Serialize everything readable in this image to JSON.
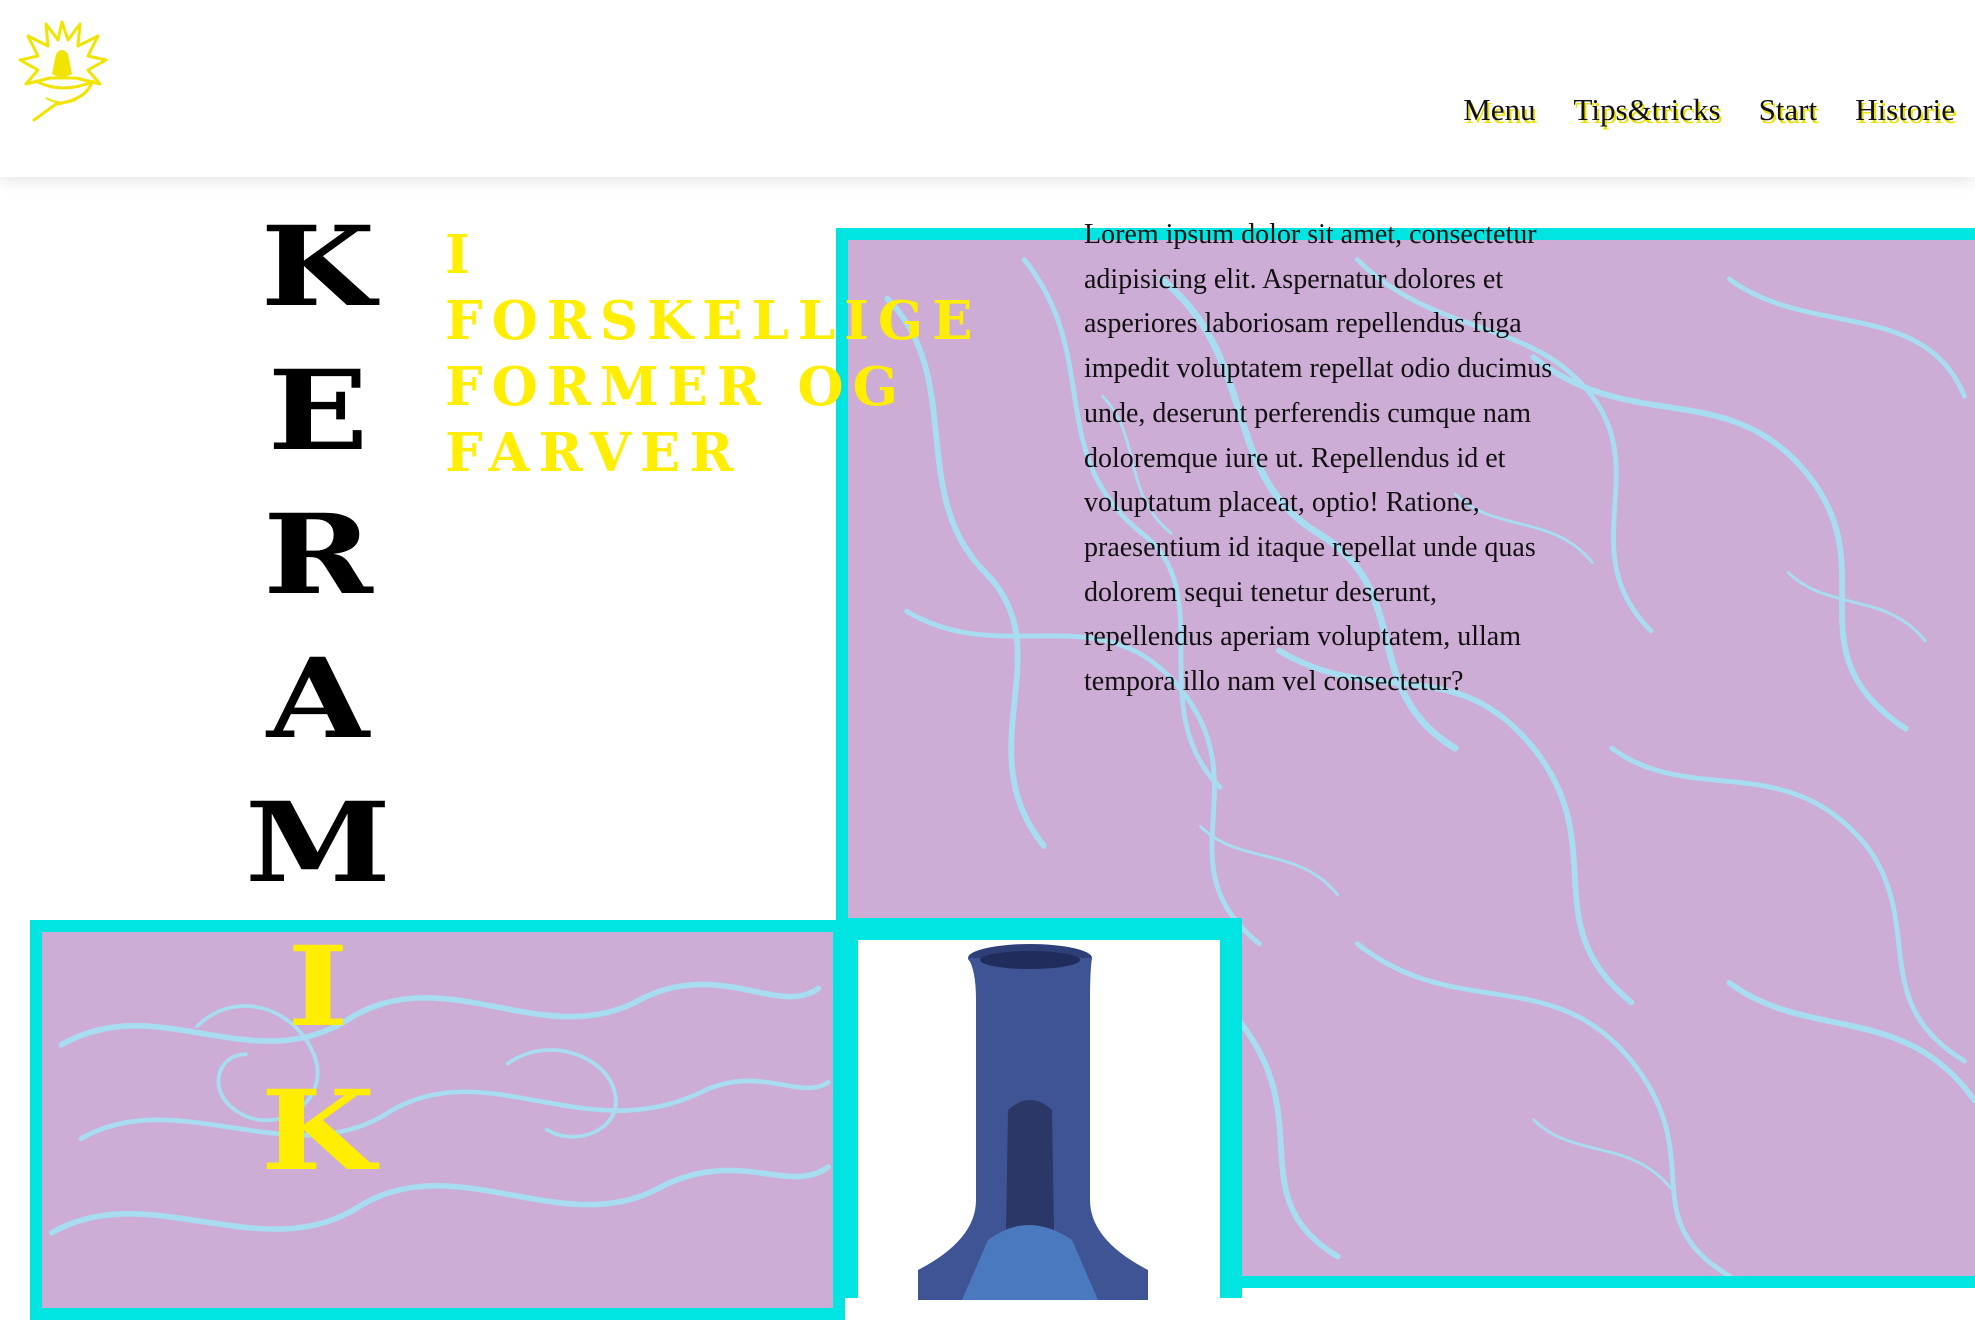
{
  "header": {
    "logo": "potter-wheel-logo-icon",
    "nav": [
      "Menu",
      "Tips&tricks",
      "Start",
      "Historie"
    ]
  },
  "hero": {
    "title_letters": [
      "K",
      "E",
      "R",
      "A",
      "M",
      "I",
      "K"
    ],
    "subtitle_lines": [
      "I",
      "FORSKELLIGE",
      "FORMER OG",
      "FARVER"
    ],
    "body": "Lorem ipsum dolor sit amet, consectetur adipisicing elit. Aspernatur dolores et asperiores laboriosam repellendus fuga impedit voluptatem repellat odio ducimus unde, deserunt perferendis cumque nam doloremque iure ut. Repellendus id et voluptatum placeat, optio! Ratione, praesentium id itaque repellat unde quas dolorem sequi tenetur deserunt, repellendus aperiam voluptatem, ullam tempora illo nam vel consectetur?"
  },
  "colors": {
    "accent_cyan": "#00e5e1",
    "marble_lilac": "#cdacd6",
    "marble_vein": "#a8dcf0",
    "title_yellow": "#ffee00",
    "nav_shadow_yellow": "#e8e000",
    "vase_blue": "#3f5494"
  }
}
